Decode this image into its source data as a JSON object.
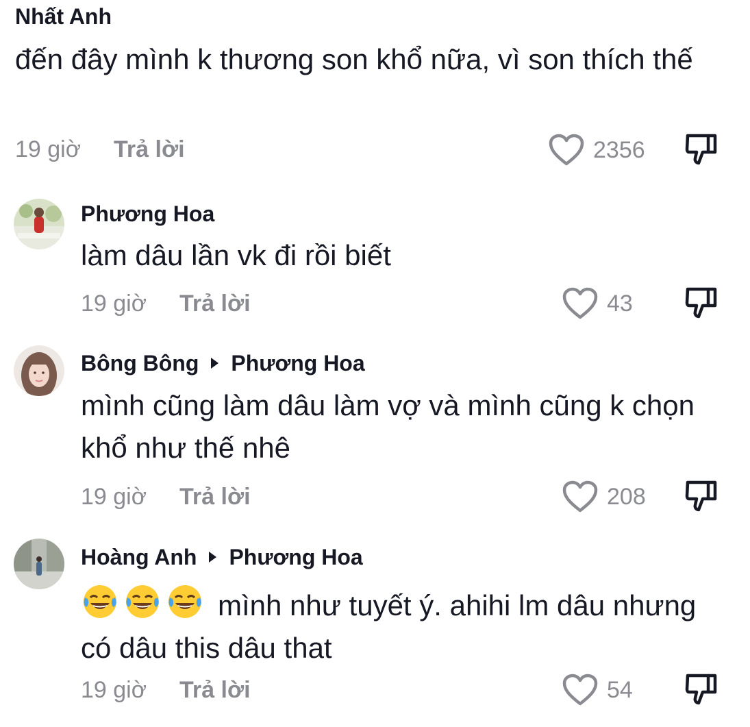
{
  "comments": [
    {
      "author": "Nhất Anh",
      "text": "đến đây mình k thương son khổ nữa, vì son thích thế",
      "time": "19 giờ",
      "reply": "Trả lời",
      "likes": "2356"
    },
    {
      "author": "Phương Hoa",
      "text": "làm dâu lần vk đi rồi biết",
      "time": "19 giờ",
      "reply": "Trả lời",
      "likes": "43"
    },
    {
      "author": "Bông Bông",
      "reply_to": "Phương Hoa",
      "text": "mình cũng làm dâu làm vợ và mình cũng k chọn khổ như thế nhê",
      "time": "19 giờ",
      "reply": "Trả lời",
      "likes": "208"
    },
    {
      "author": "Hoàng Anh",
      "reply_to": "Phương Hoa",
      "emojis": [
        "tears-of-joy-emoji",
        "tears-of-joy-emoji",
        "tears-of-joy-emoji"
      ],
      "text": "mình như tuyết ý. ahihi lm dâu nhưng có dâu this dâu that",
      "time": "19 giờ",
      "reply": "Trả lời",
      "likes": "54"
    }
  ],
  "icons": {
    "like": "heart-outline-icon",
    "dislike": "thumbs-down-icon"
  },
  "colors": {
    "text": "#161823",
    "muted": "#8a8b91",
    "background": "#ffffff"
  }
}
